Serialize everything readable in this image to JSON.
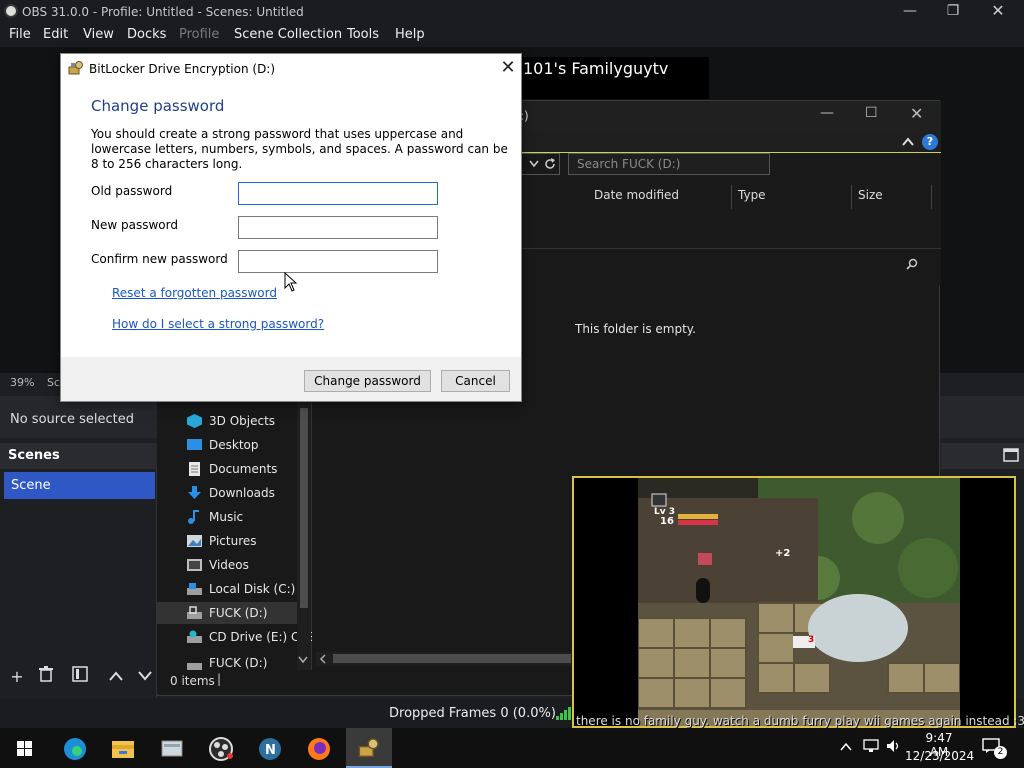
{
  "obs": {
    "title": "OBS 31.0.0 - Profile: Untitled - Scenes: Untitled",
    "menu": [
      "File",
      "Edit",
      "View",
      "Docks",
      "Profile",
      "Scene Collection",
      "Tools",
      "Help"
    ],
    "stream_title": "101's Familyguytv",
    "zoom": "39%",
    "zoom_suffix": "Sc",
    "no_source": "No source selected",
    "scenes_header": "Scenes",
    "scenes": [
      "Scene"
    ],
    "dropped_frames": "Dropped Frames 0 (0.0%)"
  },
  "explorer": {
    "title_suffix": ":)",
    "search_placeholder": "Search FUCK (D:)",
    "columns": [
      "Date modified",
      "Type",
      "Size"
    ],
    "empty_text": "This folder is empty.",
    "nav_items": [
      "3D Objects",
      "Desktop",
      "Documents",
      "Downloads",
      "Music",
      "Pictures",
      "Videos",
      "Local Disk (C:)",
      "FUCK (D:)",
      "CD Drive (E:) CES",
      "FUCK (D:)"
    ],
    "status": "0 items"
  },
  "dialog": {
    "title": "BitLocker Drive Encryption (D:)",
    "heading": "Change password",
    "description": "You should create a strong password that uses uppercase and lowercase letters, numbers, symbols, and spaces. A password can be 8 to 256 characters long.",
    "old_label": "Old password",
    "new_label": "New password",
    "confirm_label": "Confirm new password",
    "old_value": "",
    "new_value": "",
    "confirm_value": "",
    "reset_link": "Reset a forgotten password",
    "help_link": "How do I select a strong password?",
    "change_button": "Change password",
    "cancel_button": "Cancel"
  },
  "game": {
    "caption": "there is no family guy. watch a dumb furry play wii games again instead :3",
    "level": "Lv 3",
    "health": "16",
    "plus": "+2",
    "damage": "3"
  },
  "taskbar": {
    "time": "9:47 AM",
    "date": "12/23/2024",
    "notifications": "2"
  },
  "colors": {
    "accent": "#2f58c4",
    "link": "#1a56c2",
    "game_border": "#d8c24a"
  }
}
